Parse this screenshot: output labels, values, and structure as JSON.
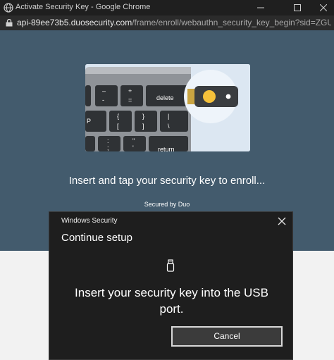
{
  "window": {
    "title": "Activate Security Key - Google Chrome",
    "icon": "chrome-globe-icon",
    "controls": [
      "minimize-icon",
      "maximize-icon",
      "close-icon"
    ]
  },
  "addressbar": {
    "url_host": "api-89ee73b5.duosecurity.com",
    "url_path": "/frame/enroll/webauthn_security_key_begin?sid=ZGUzMTZ..."
  },
  "page": {
    "illustration": {
      "keys": {
        "row1": [
          "–",
          "+",
          "delete"
        ],
        "row1_sub": [
          "-",
          "="
        ],
        "row2": [
          "P",
          "{",
          "}",
          "|"
        ],
        "row2_sub": [
          "[",
          "]",
          "\\"
        ],
        "row3": [
          ":",
          "\"",
          "return"
        ],
        "row3_sub": [
          ";",
          "'"
        ]
      }
    },
    "heading": "Insert and tap your security key to enroll...",
    "secured_by": "Secured by Duo"
  },
  "dialog": {
    "app_name": "Windows Security",
    "heading": "Continue setup",
    "message": "Insert your security key into the USB port.",
    "cancel_label": "Cancel"
  },
  "colors": {
    "page_background": "#435b6d",
    "dialog_background": "#1e1e1e",
    "key_tap_button": "#f5c13a"
  }
}
